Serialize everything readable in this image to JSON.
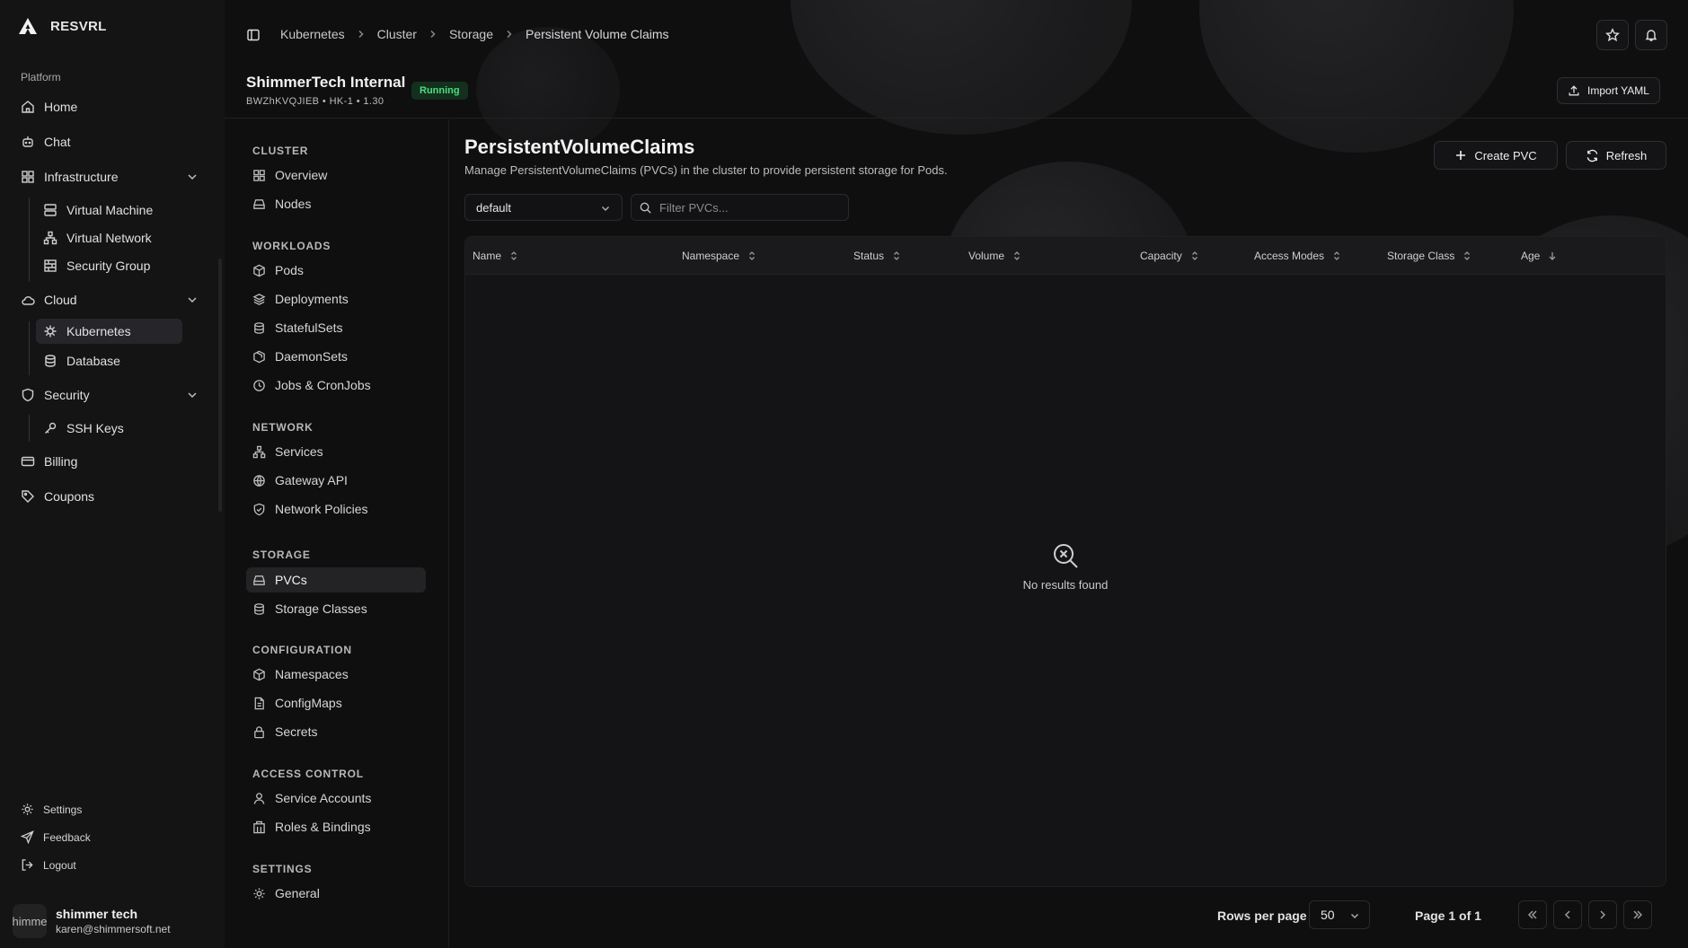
{
  "app": {
    "name": "RESVRL"
  },
  "sidebar": {
    "section_label": "Platform",
    "items": [
      {
        "label": "Home"
      },
      {
        "label": "Chat"
      },
      {
        "label": "Infrastructure"
      },
      {
        "label": "Virtual Machine"
      },
      {
        "label": "Virtual Network"
      },
      {
        "label": "Security Group"
      },
      {
        "label": "Cloud"
      },
      {
        "label": "Kubernetes"
      },
      {
        "label": "Database"
      },
      {
        "label": "Security"
      },
      {
        "label": "SSH Keys"
      },
      {
        "label": "Billing"
      },
      {
        "label": "Coupons"
      }
    ],
    "footer": {
      "settings": "Settings",
      "feedback": "Feedback",
      "logout": "Logout"
    },
    "user": {
      "avatar_text": "himme",
      "name": "shimmer tech",
      "email": "karen@shimmersoft.net"
    }
  },
  "breadcrumb": [
    "Kubernetes",
    "Cluster",
    "Storage",
    "Persistent Volume Claims"
  ],
  "cluster": {
    "name": "ShimmerTech Internal",
    "meta": "BWZhKVQJIEB  •  HK-1  •  1.30",
    "status": "Running",
    "import_label": "Import YAML"
  },
  "subnav": {
    "groups": [
      {
        "label": "CLUSTER",
        "items": [
          "Overview",
          "Nodes"
        ]
      },
      {
        "label": "WORKLOADS",
        "items": [
          "Pods",
          "Deployments",
          "StatefulSets",
          "DaemonSets",
          "Jobs & CronJobs"
        ]
      },
      {
        "label": "NETWORK",
        "items": [
          "Services",
          "Gateway API",
          "Network Policies"
        ]
      },
      {
        "label": "STORAGE",
        "items": [
          "PVCs",
          "Storage Classes"
        ]
      },
      {
        "label": "CONFIGURATION",
        "items": [
          "Namespaces",
          "ConfigMaps",
          "Secrets"
        ]
      },
      {
        "label": "ACCESS CONTROL",
        "items": [
          "Service Accounts",
          "Roles & Bindings"
        ]
      },
      {
        "label": "SETTINGS",
        "items": [
          "General"
        ]
      }
    ]
  },
  "page": {
    "title": "PersistentVolumeClaims",
    "subtitle": "Manage PersistentVolumeClaims (PVCs) in the cluster to provide persistent storage for Pods.",
    "create_label": "Create PVC",
    "refresh_label": "Refresh",
    "namespace_value": "default",
    "filter_placeholder": "Filter PVCs...",
    "columns": [
      "Name",
      "Namespace",
      "Status",
      "Volume",
      "Capacity",
      "Access Modes",
      "Storage Class",
      "Age"
    ],
    "empty_text": "No results found"
  },
  "pagination": {
    "rows_label": "Rows per page",
    "rows_value": "50",
    "page_info": "Page 1 of 1"
  }
}
